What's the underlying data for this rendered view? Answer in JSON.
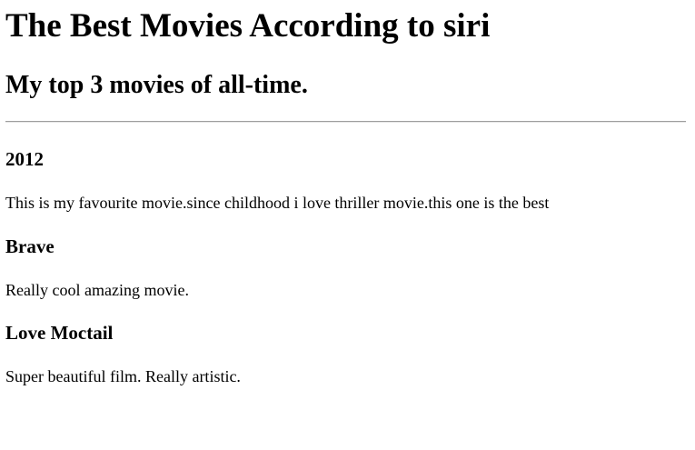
{
  "page": {
    "title": "The Best Movies According to siri",
    "subtitle": "My top 3 movies of all-time."
  },
  "movies": [
    {
      "title": "2012",
      "description": "This is my favourite movie.since childhood i love thriller movie.this one is the best"
    },
    {
      "title": "Brave",
      "description": "Really cool amazing movie."
    },
    {
      "title": "Love Moctail",
      "description": "Super beautiful film. Really artistic."
    }
  ]
}
